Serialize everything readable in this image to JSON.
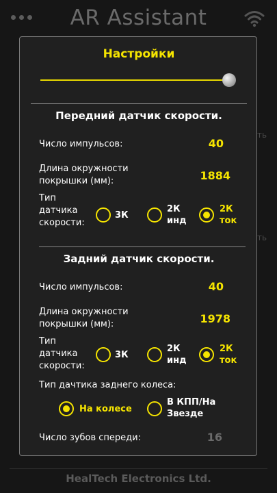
{
  "app": {
    "title": "AR Assistant",
    "footer": "HealTech Electronics Ltd."
  },
  "background": {
    "ghost1": "ть",
    "ghost2": "ть"
  },
  "dialog": {
    "title": "Настройки",
    "slider": {
      "value": 0.97
    },
    "front": {
      "title": "Передний датчик скорости.",
      "pulses_label": "Число импульсов:",
      "pulses_value": "40",
      "circ_label_1": "Длина окружности",
      "circ_label_2": "покрышки (мм):",
      "circ_value": "1884",
      "type_label_1": "Тип",
      "type_label_2": "датчика",
      "type_label_3": "скорости:",
      "options": [
        {
          "line1": "3К",
          "line2": "",
          "checked": false
        },
        {
          "line1": "2К",
          "line2": "инд",
          "checked": false
        },
        {
          "line1": "2К",
          "line2": "ток",
          "checked": true
        }
      ]
    },
    "rear": {
      "title": "Задний датчик скорости.",
      "pulses_label": "Число импульсов:",
      "pulses_value": "40",
      "circ_label_1": "Длина окружности",
      "circ_label_2": "покрышки (мм):",
      "circ_value": "1978",
      "type_label_1": "Тип",
      "type_label_2": "датчика",
      "type_label_3": "скорости:",
      "options": [
        {
          "line1": "3К",
          "line2": "",
          "checked": false
        },
        {
          "line1": "2К",
          "line2": "инд",
          "checked": false
        },
        {
          "line1": "2К",
          "line2": "ток",
          "checked": true
        }
      ],
      "wheel_type_label": "Тип дачтика заднего колеса:",
      "wheel_options": [
        {
          "line1": "На колесе",
          "line2": "",
          "checked": true
        },
        {
          "line1": "В КПП/На",
          "line2": "Звезде",
          "checked": false
        }
      ],
      "teeth_label": "Число зубов спереди:",
      "teeth_value": "16"
    }
  },
  "colors": {
    "accent": "#f5e400",
    "background": "#161616",
    "dialog": "#202020"
  }
}
